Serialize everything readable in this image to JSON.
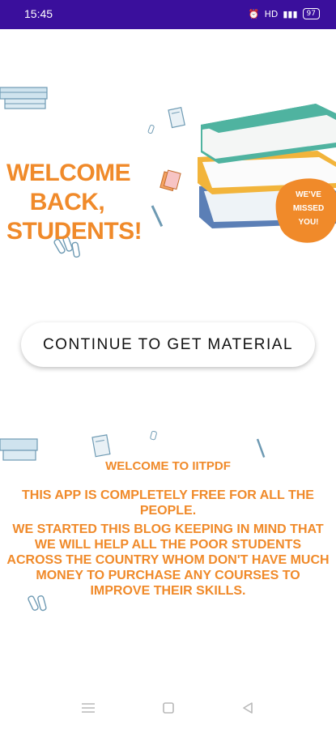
{
  "status_bar": {
    "time": "15:45",
    "icons": [
      "alarm-icon",
      "hd-icon",
      "signal-icon",
      "battery-icon"
    ],
    "battery_level": "97"
  },
  "hero": {
    "title": "WELCOME\nBACK,\nSTUDENTS!",
    "badge": "WE'VE\nMISSED\nYOU!",
    "colors": {
      "accent": "#f08a2a",
      "book_teal": "#4fb3a0",
      "book_blue": "#5b7fb6",
      "book_yellow": "#f2b43b",
      "badge": "#f08a2a"
    }
  },
  "cta": {
    "label": "CONTINUE TO GET MATERIAL"
  },
  "info": {
    "title": "WELCOME TO IITPDF",
    "line1": "THIS APP IS COMPLETELY FREE FOR ALL THE PEOPLE.",
    "paragraph": "WE STARTED THIS BLOG KEEPING IN MIND THAT WE WILL HELP ALL THE POOR STUDENTS ACROSS THE COUNTRY WHOM DON'T HAVE MUCH MONEY TO PURCHASE ANY COURSES TO IMPROVE THEIR SKILLS."
  },
  "nav": {
    "items": [
      "menu-icon",
      "home-icon",
      "back-icon"
    ]
  }
}
